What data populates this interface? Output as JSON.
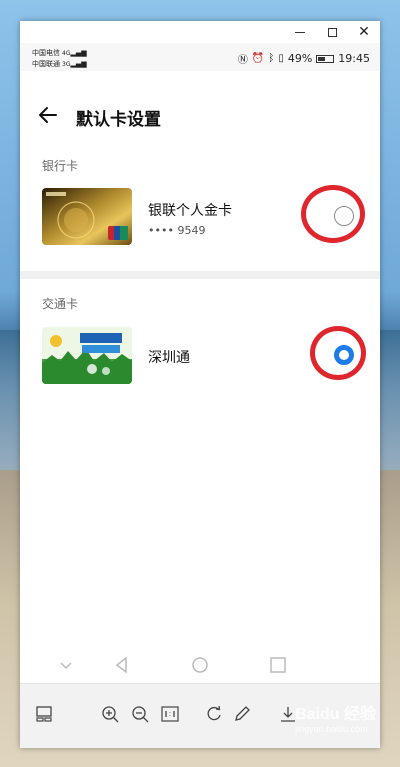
{
  "status_bar": {
    "carrier_1": "中国电信",
    "carrier_1_net": "4G",
    "carrier_2": "中国联通",
    "carrier_2_net": "3G",
    "battery": "49%",
    "battery_level": 0.49,
    "time": "19:45"
  },
  "app_bar": {
    "title": "默认卡设置"
  },
  "bank_section": {
    "label": "银行卡",
    "cards": [
      {
        "name": "银联个人金卡",
        "number": "•••• 9549",
        "selected": false,
        "card_type": "gold-unionpay-card"
      }
    ]
  },
  "transit_section": {
    "label": "交通卡",
    "cards": [
      {
        "name": "深圳通",
        "selected": true,
        "card_type": "shenzhen-tong-card"
      }
    ]
  },
  "annotations": {
    "highlight_color": "#e0262d"
  },
  "colors": {
    "radio_selected": "#1e7ce8"
  },
  "watermark": {
    "logo_text": "Baidu 经验",
    "url": "jingyan.baidu.com"
  }
}
